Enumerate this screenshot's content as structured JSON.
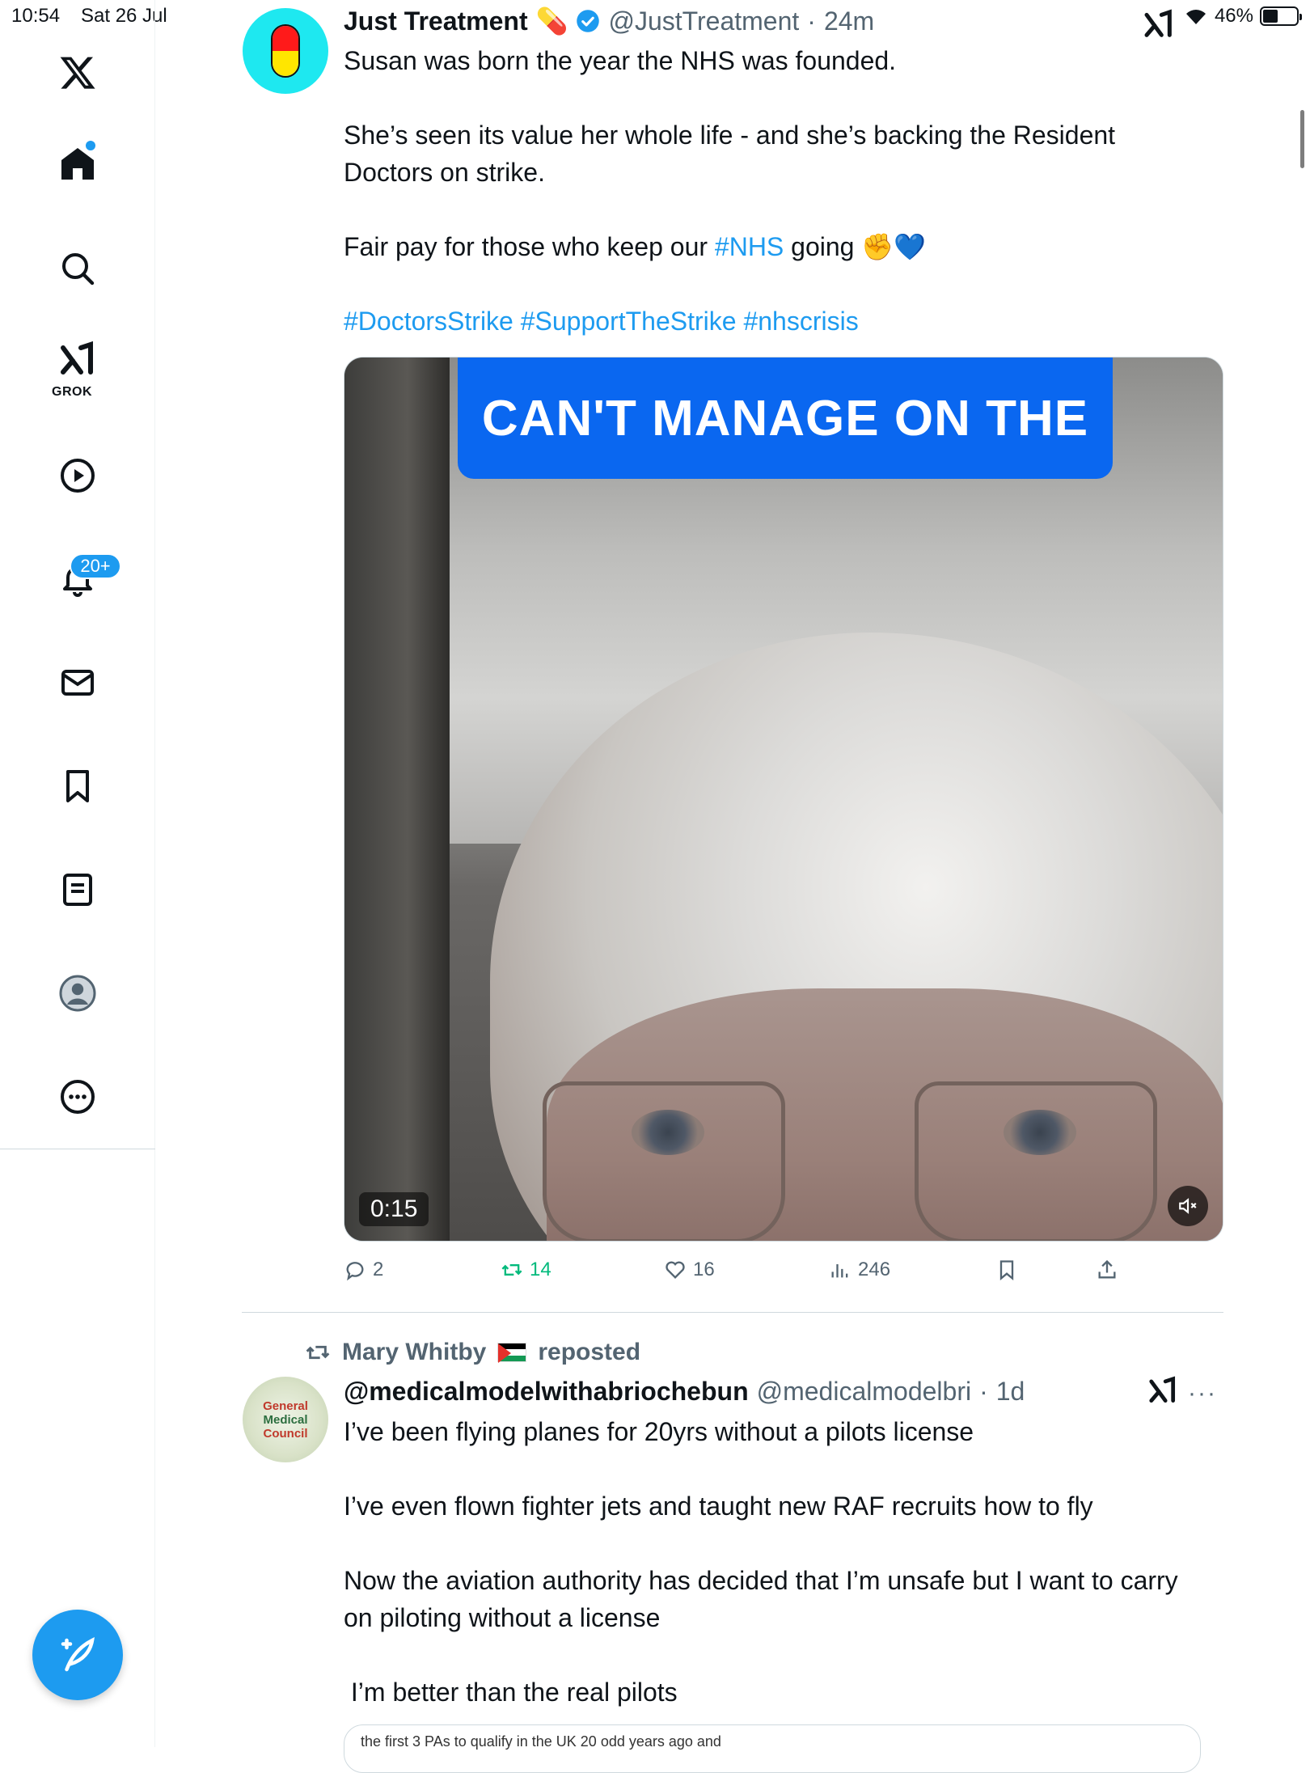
{
  "status_bar": {
    "time": "10:54",
    "date": "Sat 26 Jul",
    "battery": "46%",
    "battery_level": 0.46
  },
  "sidebar": {
    "items": [
      {
        "icon": "x-logo-icon"
      },
      {
        "icon": "home-icon"
      },
      {
        "icon": "search-icon"
      },
      {
        "icon": "grok-icon",
        "label": "GROK"
      },
      {
        "icon": "video-play-icon"
      },
      {
        "icon": "bell-icon",
        "badge": "20+"
      },
      {
        "icon": "mail-icon"
      },
      {
        "icon": "bookmark-icon"
      },
      {
        "icon": "lists-icon"
      },
      {
        "icon": "profile-icon"
      },
      {
        "icon": "more-icon"
      }
    ],
    "compose_icon": "compose-feather-icon"
  },
  "tweet1": {
    "name": "Just Treatment",
    "name_emoji": "💊",
    "handle": "@JustTreatment",
    "separator": "·",
    "time": "24m",
    "paragraphs": [
      "Susan was born the year the NHS was founded.",
      "She’s seen its value her whole life - and she’s backing the Resident Doctors on strike."
    ],
    "line3_prefix": "Fair pay for those who keep our ",
    "line3_tag": "#NHS",
    "line3_suffix": " going ✊💙",
    "hashtags": "#DoctorsStrike #SupportTheStrike #nhscrisis",
    "video": {
      "banner_text": "CAN'T MANAGE ON THE",
      "duration": "0:15",
      "banner_color": "#0a67f0"
    },
    "actions": {
      "replies": "2",
      "reposts": "14",
      "likes": "16",
      "views": "246"
    }
  },
  "tweet2": {
    "reposted_by": "Mary Whitby",
    "reposted_label": "reposted",
    "name": "@medicalmodelwithabriochebun",
    "handle": "@medicalmodelbri",
    "separator": "·",
    "time": "1d",
    "avatar_text": [
      "General",
      "Medical",
      "Council"
    ],
    "paragraphs": [
      "I’ve been flying planes for 20yrs without a pilots license",
      "I’ve even flown fighter jets and taught new RAF recruits how to fly",
      "Now the aviation authority has decided that I’m unsafe but I want to carry on piloting without a license",
      " I’m better than the real pilots"
    ],
    "quote_preview": "the first 3 PAs to qualify in the UK 20 odd years ago and"
  },
  "colors": {
    "accent": "#1d9bf0",
    "repost_green": "#00ba7c",
    "muted_text": "#536471",
    "avatar_cyan": "#1ee8f0"
  }
}
